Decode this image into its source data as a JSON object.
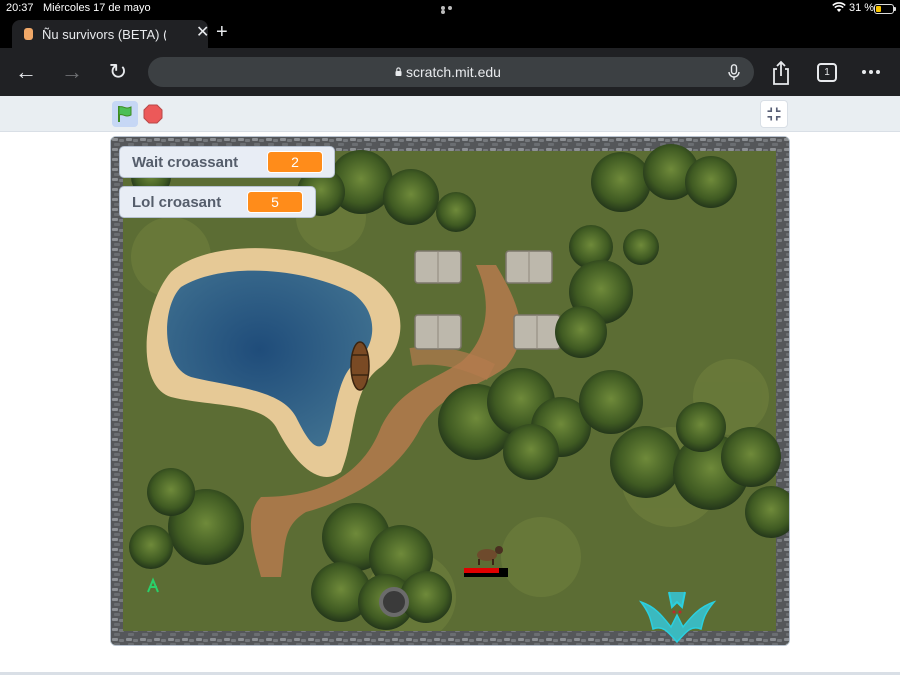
{
  "status_bar": {
    "time": "20:37",
    "date": "Miércoles 17 de mayo",
    "battery": "31 %",
    "battery_level": 0.31
  },
  "browser": {
    "tab_title": "Ñu survivors (BETA) (W.I",
    "url": "scratch.mit.edu",
    "tab_count": "1"
  },
  "stage": {
    "monitors": [
      {
        "label": "Wait croassant",
        "value": "2"
      },
      {
        "label": "Lol croasant",
        "value": "5"
      }
    ],
    "player_health": 0.8
  },
  "colors": {
    "accent_orange": "#ff8c1a",
    "grass": "#5a6b32",
    "water": "#2d5f8a",
    "sand": "#e3c58f",
    "path": "#b4774c",
    "health_red": "#e00000"
  }
}
